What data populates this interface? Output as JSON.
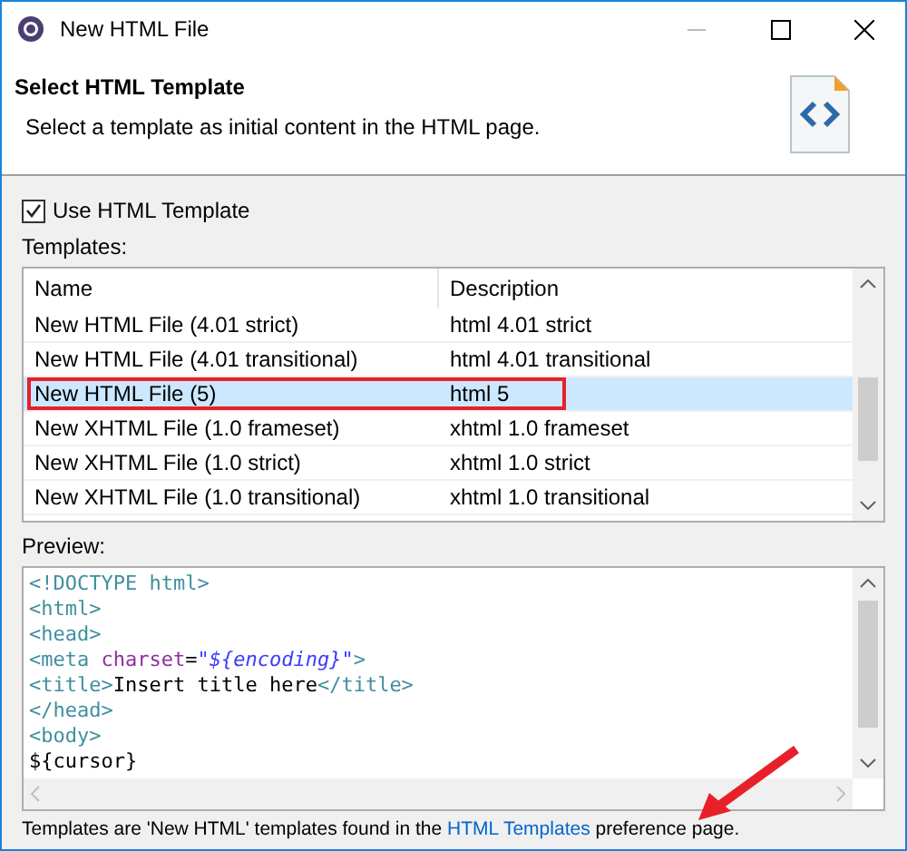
{
  "window": {
    "title": "New HTML File"
  },
  "header": {
    "title": "Select HTML Template",
    "description": "Select a template as initial content in the HTML page."
  },
  "use_template": {
    "label": "Use HTML Template",
    "checked": true
  },
  "templates": {
    "label": "Templates:",
    "columns": [
      "Name",
      "Description"
    ],
    "rows": [
      {
        "name": "New HTML File (4.01 strict)",
        "description": "html 4.01 strict",
        "selected": false
      },
      {
        "name": "New HTML File (4.01 transitional)",
        "description": "html 4.01 transitional",
        "selected": false
      },
      {
        "name": "New HTML File (5)",
        "description": "html 5",
        "selected": true
      },
      {
        "name": "New XHTML File (1.0 frameset)",
        "description": "xhtml 1.0 frameset",
        "selected": false
      },
      {
        "name": "New XHTML File (1.0 strict)",
        "description": "xhtml 1.0 strict",
        "selected": false
      },
      {
        "name": "New XHTML File (1.0 transitional)",
        "description": "xhtml 1.0 transitional",
        "selected": false
      }
    ]
  },
  "preview": {
    "label": "Preview:",
    "lines": [
      [
        {
          "kind": "tag",
          "text": "<!DOCTYPE html>"
        }
      ],
      [
        {
          "kind": "tag",
          "text": "<html>"
        }
      ],
      [
        {
          "kind": "tag",
          "text": "<head>"
        }
      ],
      [
        {
          "kind": "tag",
          "text": "<meta "
        },
        {
          "kind": "attr",
          "text": "charset"
        },
        {
          "kind": "plain",
          "text": "="
        },
        {
          "kind": "string",
          "text": "\"${encoding}\""
        },
        {
          "kind": "tag",
          "text": ">"
        }
      ],
      [
        {
          "kind": "tag",
          "text": "<title>"
        },
        {
          "kind": "plain",
          "text": "Insert title here"
        },
        {
          "kind": "tag",
          "text": "</title>"
        }
      ],
      [
        {
          "kind": "tag",
          "text": "</head>"
        }
      ],
      [
        {
          "kind": "tag",
          "text": "<body>"
        }
      ],
      [
        {
          "kind": "plain",
          "text": "${cursor}"
        }
      ]
    ]
  },
  "footer": {
    "before": "Templates are 'New HTML' templates found in the ",
    "link": "HTML Templates",
    "after": " preference page."
  }
}
